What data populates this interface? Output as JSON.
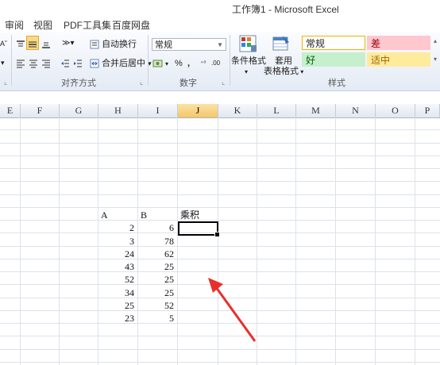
{
  "window": {
    "title": "工作簿1 - Microsoft Excel"
  },
  "ribbon_tabs": [
    "审阅",
    "视图",
    "PDF工具集",
    "百度网盘"
  ],
  "ribbon": {
    "alignment": {
      "wrap_text": "自动换行",
      "merge_center": "合并后居中",
      "merge_arrow": "▾",
      "group_label": "对齐方式",
      "cut_label": "A˘"
    },
    "number": {
      "format_value": "常规",
      "group_label": "数字",
      "percent": "%",
      "comma": ",",
      "inc_decimal": "⁺⁰",
      "dec_decimal": ".00"
    },
    "styles": {
      "conditional_format": "条件格式",
      "table_format_line1": "套用",
      "table_format_line2": "表格格式",
      "group_label": "样式",
      "cells": [
        {
          "label": "常规",
          "bg": "#ffffff",
          "border": "#f0b400",
          "color": "#222222"
        },
        {
          "label": "差",
          "bg": "#ffc7ce",
          "border": "#ffc7ce",
          "color": "#9c0006"
        },
        {
          "label": "好",
          "bg": "#c6efce",
          "border": "#c6efce",
          "color": "#006100"
        },
        {
          "label": "适中",
          "bg": "#ffeb9c",
          "border": "#ffeb9c",
          "color": "#9c6500"
        }
      ]
    }
  },
  "columns": [
    "E",
    "F",
    "G",
    "H",
    "I",
    "J",
    "K",
    "L",
    "M",
    "N",
    "O",
    "P"
  ],
  "active_column": "J",
  "sheet": {
    "header_row": {
      "H": "A",
      "I": "B",
      "J": "乘积"
    },
    "rows": [
      {
        "H": "2",
        "I": "6"
      },
      {
        "H": "3",
        "I": "78"
      },
      {
        "H": "24",
        "I": "62"
      },
      {
        "H": "43",
        "I": "25"
      },
      {
        "H": "52",
        "I": "25"
      },
      {
        "H": "34",
        "I": "25"
      },
      {
        "H": "25",
        "I": "52"
      },
      {
        "H": "23",
        "I": "5"
      }
    ]
  },
  "annotation": {
    "color": "#e8302a"
  }
}
